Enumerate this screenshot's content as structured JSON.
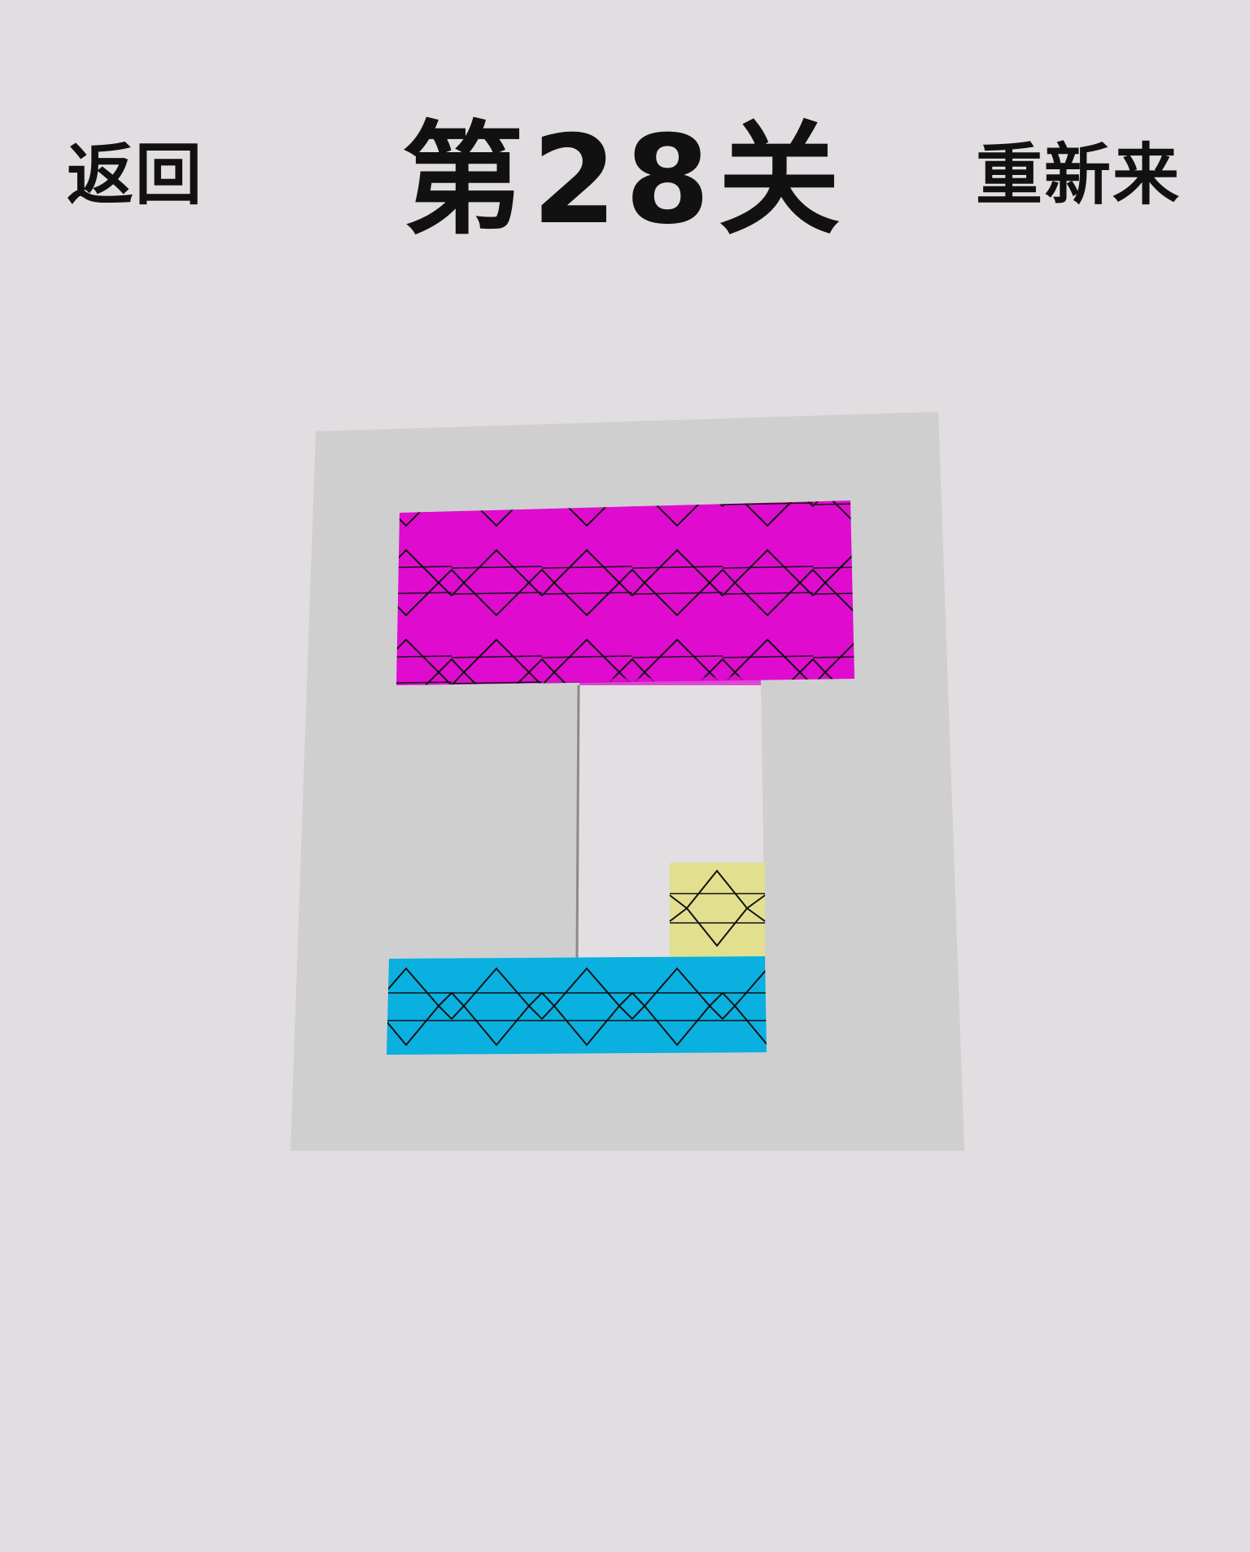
{
  "header": {
    "back_label": "返回",
    "level_title": "第28关",
    "restart_label": "重新来"
  },
  "colors": {
    "background": "#e1dde1",
    "board": "#cfcfcf",
    "exit_channel": "#e1dde1",
    "magenta_block": "#df0bcf",
    "blue_block": "#09b0e0",
    "yellow_block": "#e2df8f",
    "pattern_line": "#111111"
  },
  "blocks": [
    {
      "name": "magenta-block",
      "color": "magenta_block",
      "cols": 5,
      "rows": 2
    },
    {
      "name": "blue-block",
      "color": "blue_block",
      "cols": 4,
      "rows": 1
    },
    {
      "name": "yellow-block",
      "color": "yellow_block",
      "cols": 1,
      "rows": 1
    }
  ]
}
